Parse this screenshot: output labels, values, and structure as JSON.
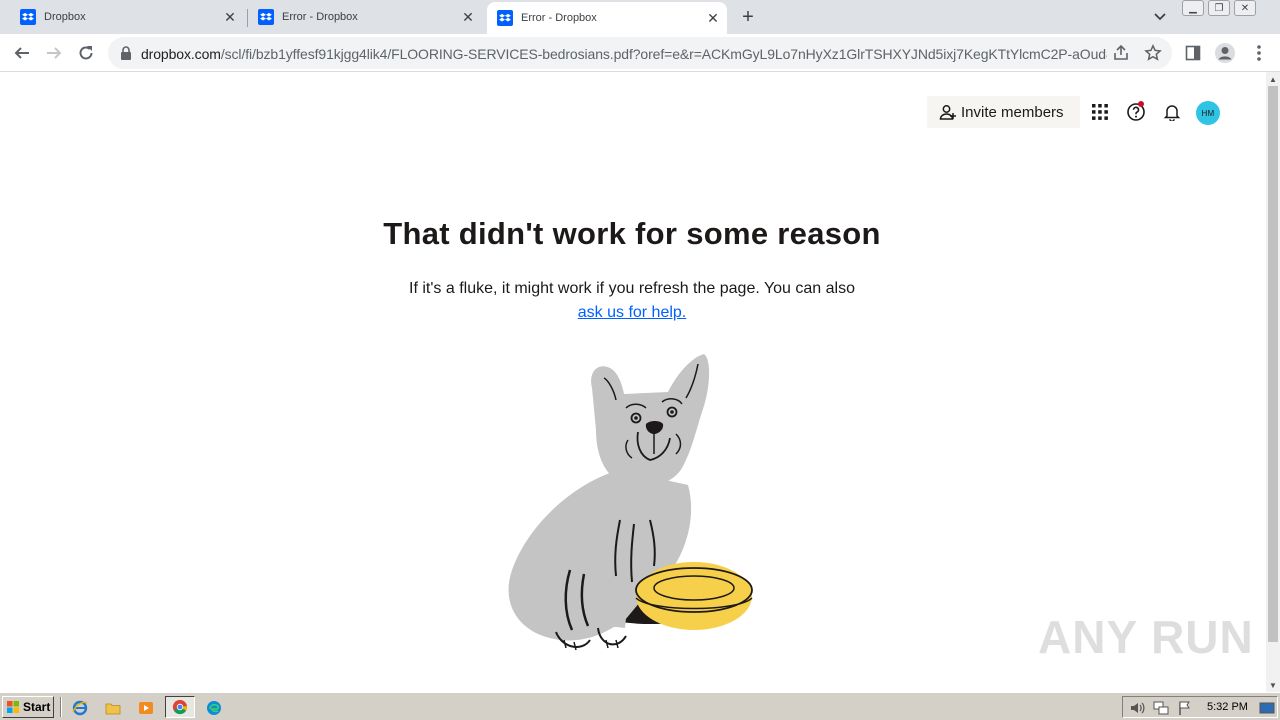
{
  "browser": {
    "tabs": [
      {
        "title": "Dropbox",
        "active": false
      },
      {
        "title": "Error - Dropbox",
        "active": false
      },
      {
        "title": "Error - Dropbox",
        "active": true
      }
    ],
    "url_host": "dropbox.com",
    "url_path": "/scl/fi/bzb1yffesf91kjgg4lik4/FLOORING-SERVICES-bedrosians.pdf?oref=e&r=ACKmGyL9Lo7nHyXz1GlrTSHXYJNd5ixj7KegKTtYlcmC2P-aOud8...",
    "new_tab_symbol": "+"
  },
  "header": {
    "invite_label": "Invite members",
    "avatar_initials": "HM",
    "accent_color": "#2fc4e3"
  },
  "error": {
    "title": "That didn't work for some reason",
    "body": "If it's a fluke, it might work if you refresh the page. You can also",
    "link_text": "ask us for help."
  },
  "watermark": "ANY RUN",
  "taskbar": {
    "start_label": "Start",
    "clock": "5:32 PM"
  }
}
